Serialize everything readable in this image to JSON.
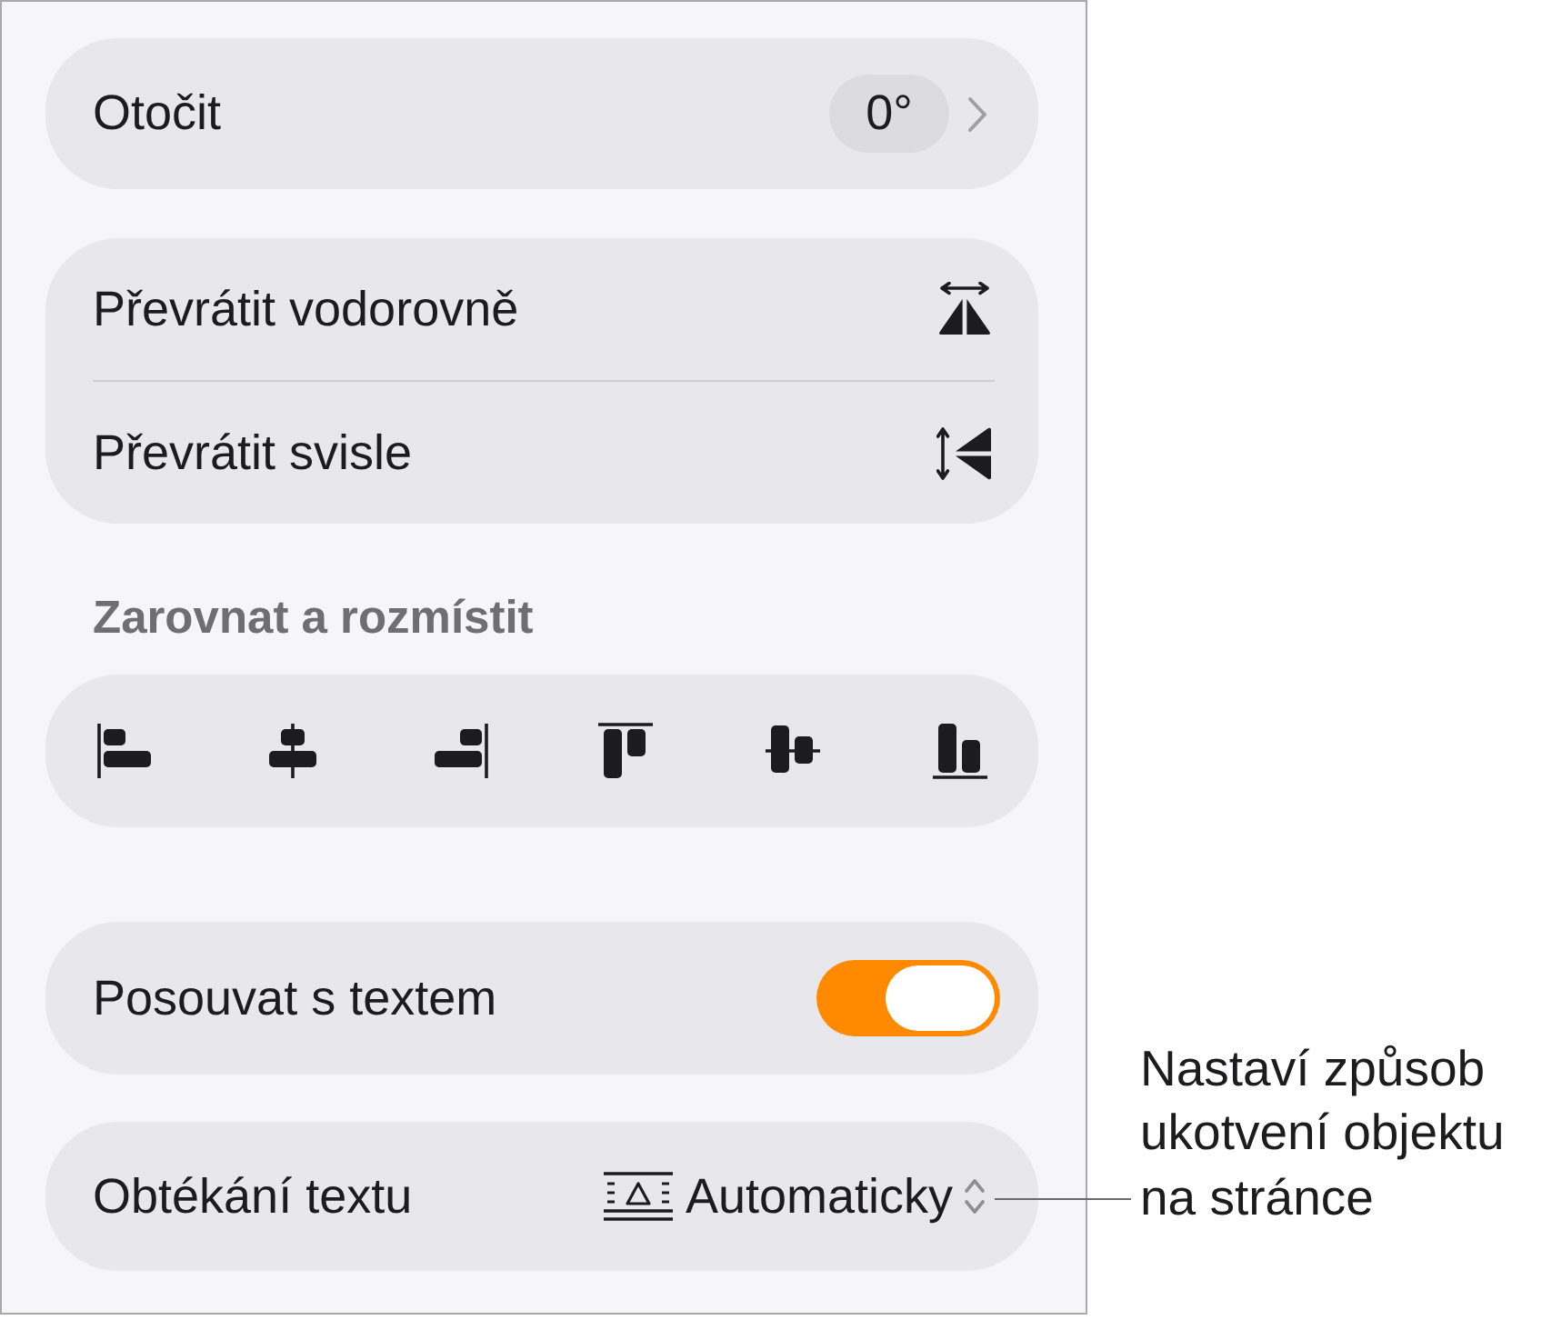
{
  "rotate": {
    "label": "Otočit",
    "value": "0°"
  },
  "flip": [
    {
      "label": "Převrátit vodorovně",
      "kind": "horizontal"
    },
    {
      "label": "Převrátit svisle",
      "kind": "vertical"
    }
  ],
  "arrange": {
    "heading": "Zarovnat a rozmístit"
  },
  "move_with_text": {
    "label": "Posouvat s textem",
    "on": true
  },
  "text_wrap": {
    "label": "Obtékání textu",
    "value": "Automaticky"
  },
  "callout": {
    "text": "Nastaví způsob ukotvení objektu na stránce"
  }
}
